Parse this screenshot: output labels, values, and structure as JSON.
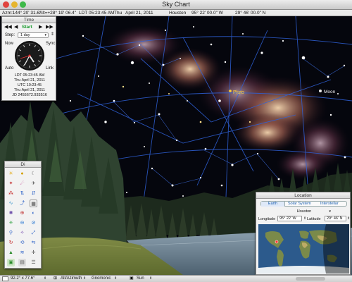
{
  "window": {
    "title": "Sky Chart"
  },
  "infobar": {
    "azimuth": "Azm:144° 20' 31.6\"",
    "altitude": "Alt=+28° 19' 06.4\"",
    "ldt": "LDT 05:23:45 AM",
    "weekday": "Thu",
    "date": "April 21, 2011",
    "city": "Houston",
    "longitude": "95° 22' 00.0\" W",
    "latitude": "29° 46' 00.0\" N"
  },
  "time_panel": {
    "title": "Time",
    "start_label": "Start",
    "step_label": "Step:",
    "step_value": "1 day",
    "now_label": "Now",
    "sync_label": "Sync",
    "auto_label": "Auto",
    "link_label": "Link",
    "ldt_time": "LDT 05:23:45 AM",
    "ldt_date": "Thu April 21, 2011",
    "utc_time": "UTC 10:23:45",
    "utc_date": "Thu April 21, 2011",
    "jd": "JD 2455672.933516"
  },
  "tool_panel": {
    "title": "Di"
  },
  "sky_labels": {
    "planet": "Pluto",
    "moon": "Moon"
  },
  "location_panel": {
    "title": "Location",
    "tabs": [
      "Earth",
      "Solar System",
      "Interstellar"
    ],
    "city": "Houston",
    "longitude_label": "Longitude",
    "longitude_value": "95° 22' W",
    "latitude_label": "Latitude",
    "latitude_value": "29° 46' N"
  },
  "statusbar": {
    "fov": "92.2° x 77.6°",
    "coords": "Alt/Azimuth",
    "projection": "Gnomonic",
    "body": "Sun"
  },
  "colors": {
    "accent_green": "#1a9b2e",
    "tab_selected": "#1b5fb0",
    "planet_label": "#ffd23a"
  }
}
